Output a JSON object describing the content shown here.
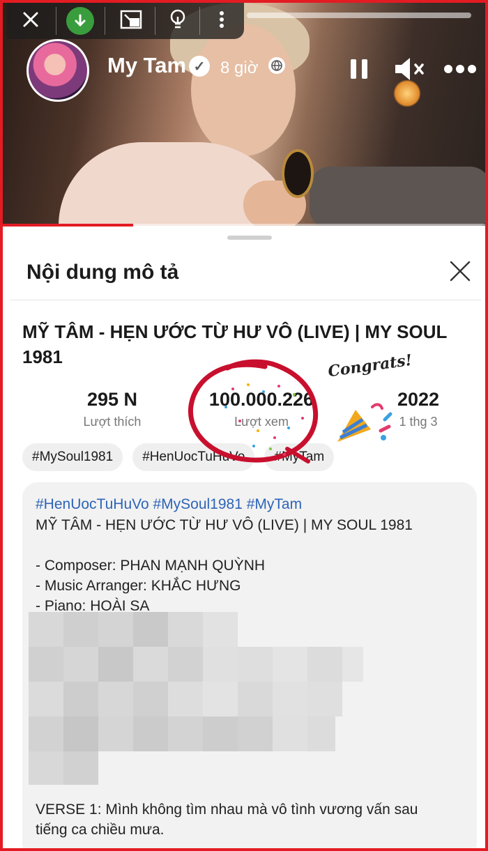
{
  "video": {
    "user_name": "My Tam",
    "post_time": "8 giờ",
    "progress": 0.27
  },
  "sheet": {
    "title": "Nội dung mô tả"
  },
  "video_title": "MỸ TÂM - HẸN ƯỚC TỪ HƯ VÔ (LIVE) | MY SOUL 1981",
  "stats": [
    {
      "value": "295 N",
      "label": "Lượt thích"
    },
    {
      "value": "100.000.226",
      "label": "Lượt xem"
    },
    {
      "value": "2022",
      "label": "1 thg 3"
    }
  ],
  "tags": [
    "#MySoul1981",
    "#HenUocTuHuVo",
    "#MyTam"
  ],
  "description": {
    "hashtags": "#HenUocTuHuVo #MySoul1981 #MyTam",
    "title_line": "MỸ TÂM - HẸN ƯỚC TỪ HƯ VÔ (LIVE) | MY SOUL 1981",
    "composer": "- Composer: PHAN MẠNH QUỲNH",
    "arranger": "- Music Arranger: KHẮC HƯNG",
    "piano": "- Piano: HOÀI SA",
    "verse_line1": "VERSE 1: Mình không tìm nhau mà vô tình vương vấn sau",
    "verse_line2": "tiếng ca chiều mưa."
  },
  "annotation": {
    "sticker_text": "Congrats!"
  },
  "colors": {
    "frame_border": "#e31b23",
    "link_blue": "#2d64b7",
    "progress_red": "#e31b23",
    "annotation_red": "#c8102e"
  },
  "icons": {
    "close": "close-icon",
    "download": "download-icon",
    "pip": "picture-in-picture-icon",
    "bulb": "lightbulb-icon",
    "more_vertical": "more-vertical-icon",
    "verified": "verified-badge-icon",
    "globe": "globe-icon",
    "pause": "pause-icon",
    "mute": "mute-icon",
    "more_horizontal": "more-horizontal-icon",
    "sheet_close": "close-icon"
  }
}
